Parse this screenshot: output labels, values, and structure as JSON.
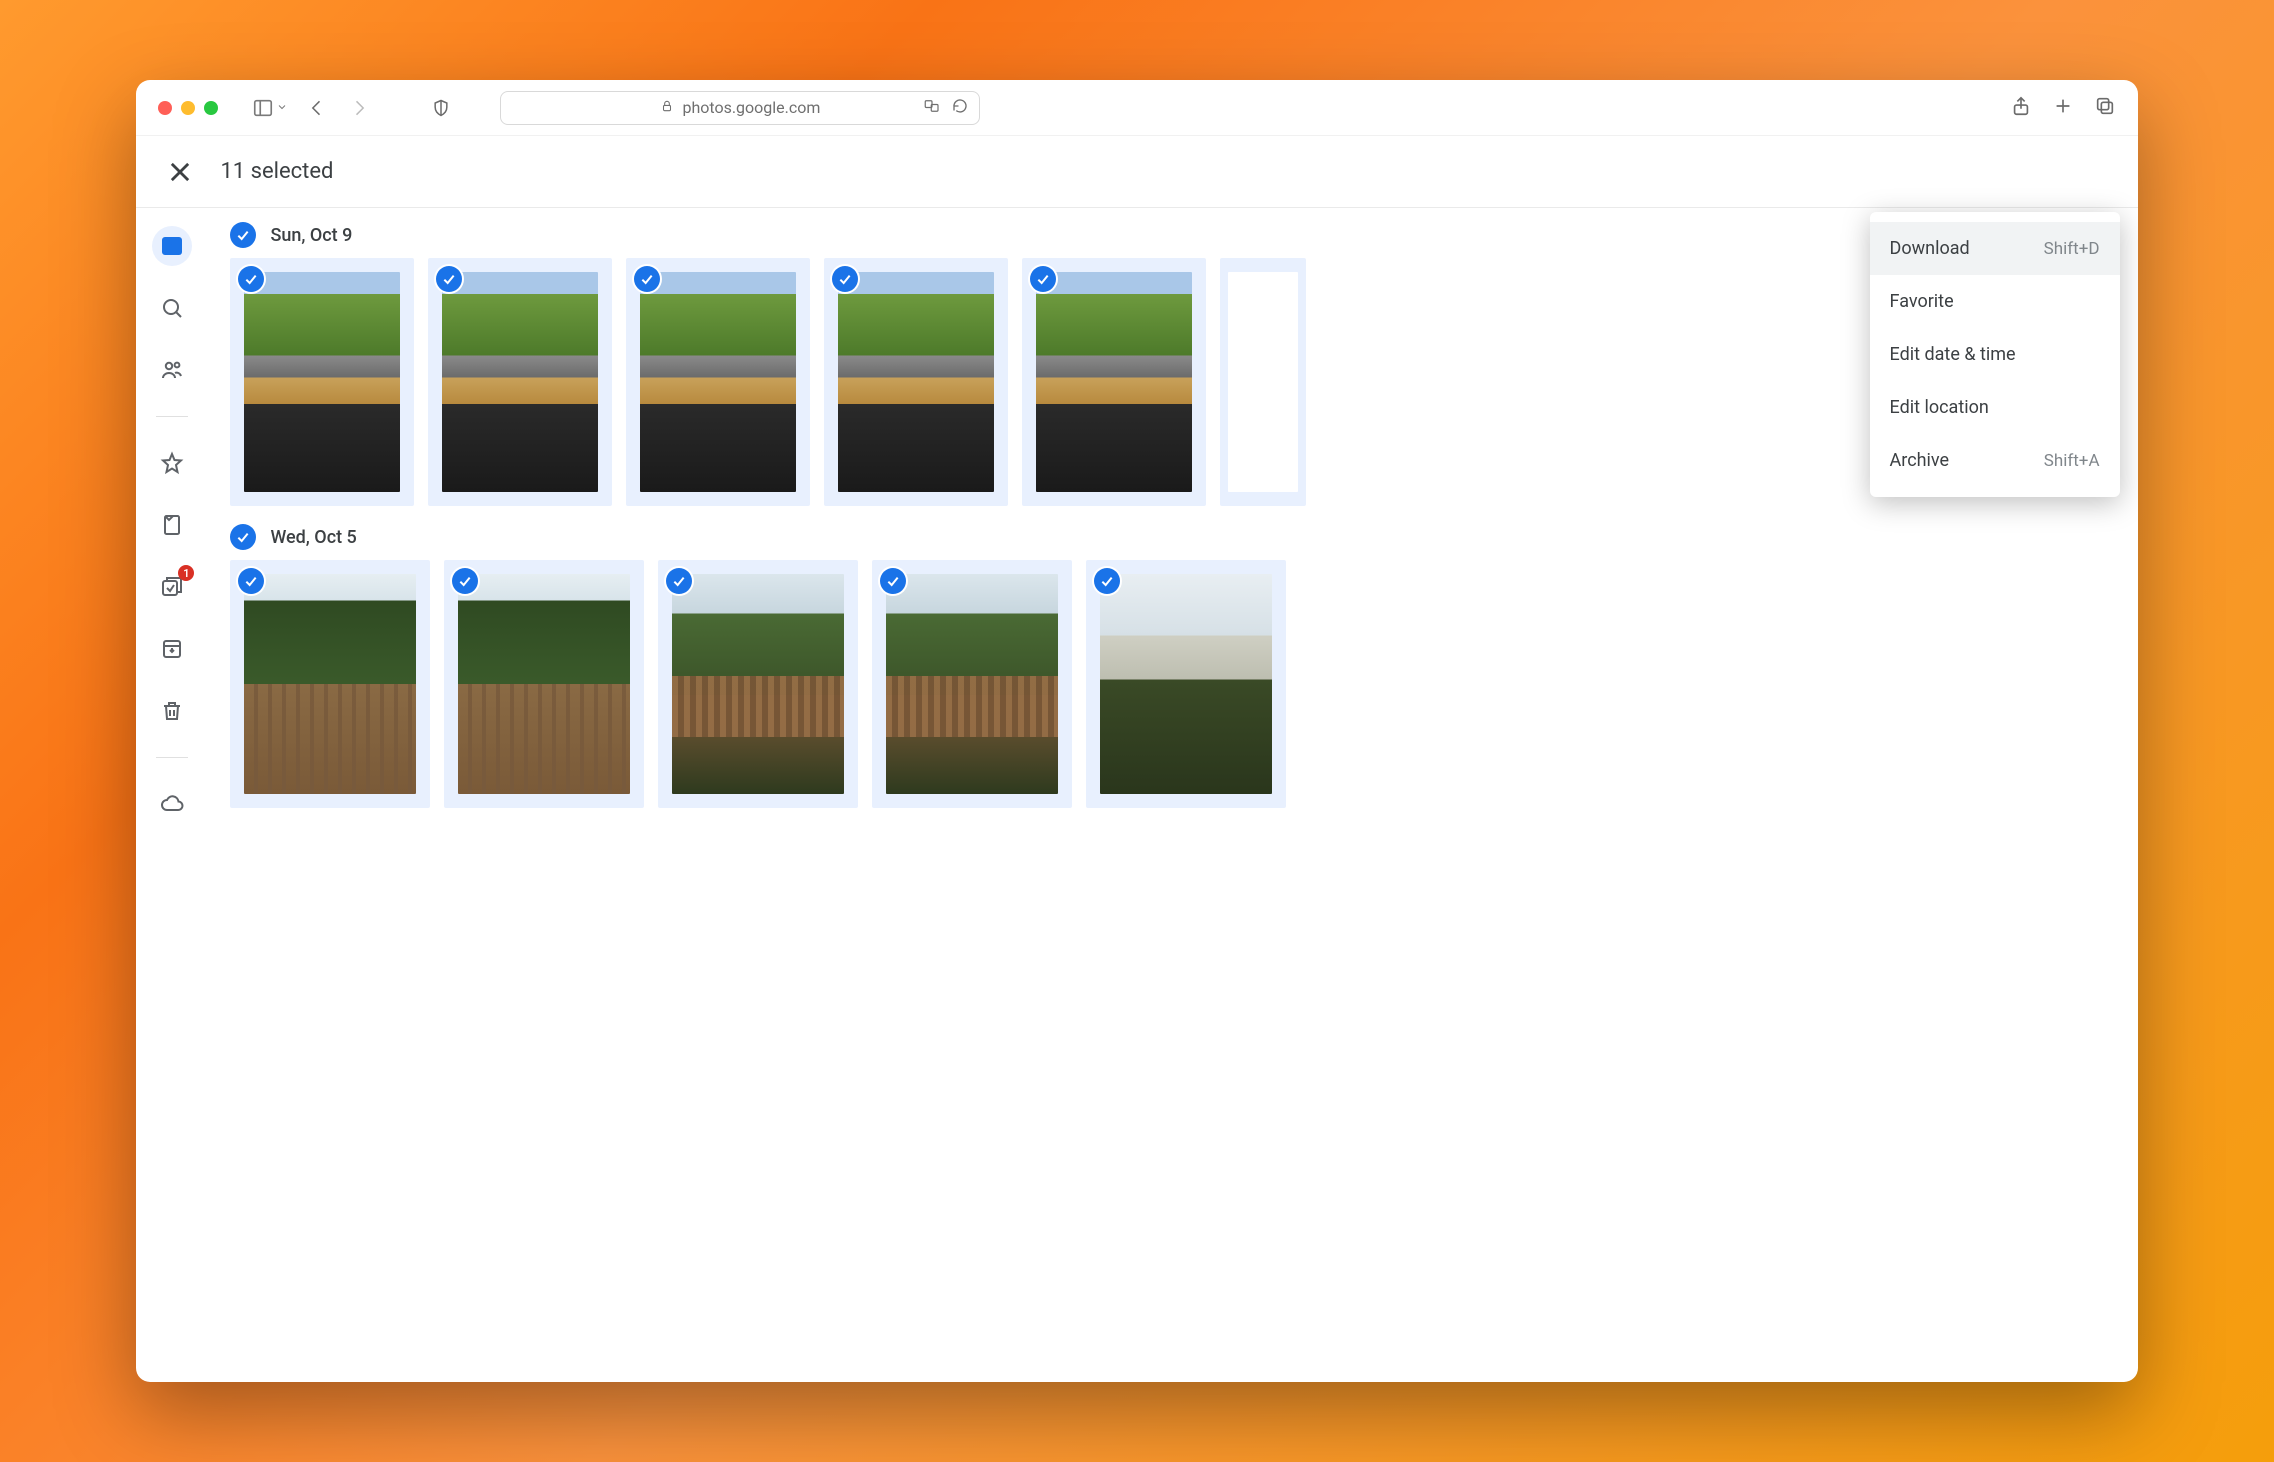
{
  "browser": {
    "url_host": "photos.google.com"
  },
  "app_header": {
    "selection_text": "11 selected"
  },
  "left_rail": {
    "badge_count": "1"
  },
  "groups": [
    {
      "date_label": "Sun, Oct 9"
    },
    {
      "date_label": "Wed, Oct 5"
    }
  ],
  "menu": {
    "items": [
      {
        "label": "Download",
        "shortcut": "Shift+D",
        "hover": true
      },
      {
        "label": "Favorite",
        "shortcut": "",
        "hover": false
      },
      {
        "label": "Edit date & time",
        "shortcut": "",
        "hover": false
      },
      {
        "label": "Edit location",
        "shortcut": "",
        "hover": false
      },
      {
        "label": "Archive",
        "shortcut": "Shift+A",
        "hover": false
      }
    ]
  }
}
